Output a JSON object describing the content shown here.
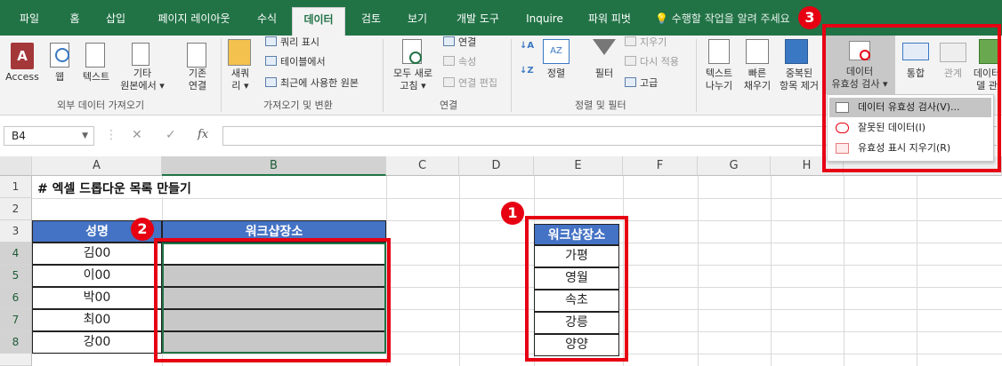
{
  "tabs": [
    "파일",
    "홈",
    "삽입",
    "페이지 레이아웃",
    "수식",
    "데이터",
    "검토",
    "보기",
    "개발 도구",
    "Inquire",
    "파워 피벗"
  ],
  "search_placeholder": "수행할 작업을 알려 주세요",
  "ribbon": {
    "access": "Access",
    "web": "웹",
    "text": "텍스트",
    "other_line1": "기타",
    "other_line2": "원본에서 ▾",
    "existing_line1": "기존",
    "existing_line2": "연결",
    "group_external": "외부 데이터 가져오기",
    "new_query_line1": "새쿼",
    "new_query_line2": "리 ▾",
    "show_queries": "쿼리 표시",
    "from_table": "테이블에서",
    "recent_sources": "최근에 사용한 원본",
    "group_get_transform": "가져오기 및 변환",
    "refresh_all_line1": "모두 새로",
    "refresh_all_line2": "고침 ▾",
    "connections": "연결",
    "properties": "속성",
    "edit_links": "연결 편집",
    "group_connections": "연결",
    "sort": "정렬",
    "filter": "필터",
    "clear": "지우기",
    "reapply": "다시 적용",
    "advanced": "고급",
    "group_sort_filter": "정렬 및 필터",
    "text_to_columns_line1": "텍스트",
    "text_to_columns_line2": "나누기",
    "flash_fill_line1": "빠른",
    "flash_fill_line2": "채우기",
    "remove_dup_line1": "중복된",
    "remove_dup_line2": "항목 제거",
    "data_validation_line1": "데이터",
    "data_validation_line2": "유효성 검사 ▾",
    "consolidate": "통합",
    "relationships": "관계",
    "data_model_line1": "데이터",
    "data_model_line2": "델 관"
  },
  "dropdown": {
    "item1": "데이터 유효성 검사(V)...",
    "item2": "잘못된 데이터(I)",
    "item3": "유효성 표시 지우기(R)"
  },
  "formula_bar": {
    "name_box": "B4",
    "name_dd": "▼",
    "cancel": "✕",
    "enter": "✓",
    "fx": "fx"
  },
  "columns": [
    "A",
    "B",
    "C",
    "D",
    "E",
    "F",
    "G",
    "H"
  ],
  "rows": [
    "1",
    "2",
    "3",
    "4",
    "5",
    "6",
    "7",
    "8"
  ],
  "sheet": {
    "title": "# 엑셀 드롭다운 목록 만들기",
    "header_name": "성명",
    "header_place": "워크샵장소",
    "names": [
      "김00",
      "이00",
      "박00",
      "최00",
      "강00"
    ],
    "list_header": "워크샵장소",
    "places": [
      "가평",
      "영월",
      "속초",
      "강릉",
      "양양"
    ]
  },
  "badges": [
    "1",
    "2",
    "3"
  ],
  "colors": {
    "excel_green": "#217346",
    "header_blue": "#4472c4",
    "callout_red": "#e60012",
    "selection_gray": "#c8c8c8"
  }
}
